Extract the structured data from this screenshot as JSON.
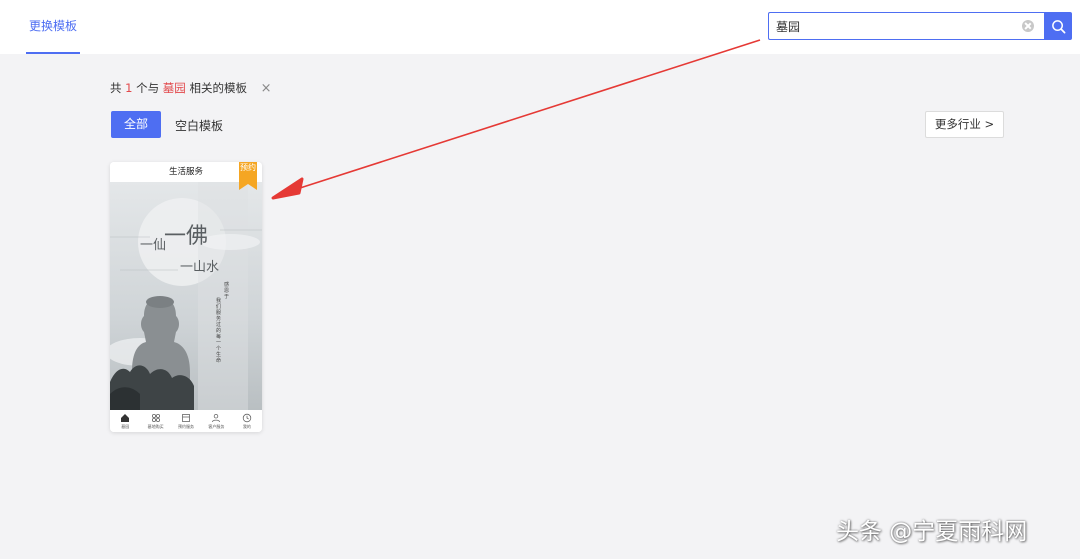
{
  "header": {
    "tab_label": "更换模板"
  },
  "search": {
    "value": "墓园"
  },
  "results": {
    "prefix": "共",
    "count": "1",
    "mid": "个与",
    "keyword": "墓园",
    "suffix": "相关的模板",
    "close": "×"
  },
  "filters": {
    "all_label": "全部",
    "blank_label": "空白模板",
    "more_label": "更多行业 >"
  },
  "template_card": {
    "title": "生活服务",
    "ribbon": "预约",
    "poster": {
      "line1_a": "一仙",
      "line1_b": "一佛",
      "line2": "一山水",
      "vertical_1": "感恩于",
      "vertical_2": "我们服务过的每一个生命"
    },
    "nav": [
      {
        "label": "墓园",
        "icon": "home-icon"
      },
      {
        "label": "墓地购买",
        "icon": "grid-icon"
      },
      {
        "label": "预约服务",
        "icon": "calendar-icon"
      },
      {
        "label": "客户服务",
        "icon": "person-icon"
      },
      {
        "label": "我的",
        "icon": "clock-icon"
      }
    ]
  },
  "watermark": "头条 @宁夏雨科网",
  "colors": {
    "accent": "#4e6ef2",
    "highlight": "#e2484b",
    "ribbon": "#f5a623",
    "arrow": "#e53935"
  }
}
